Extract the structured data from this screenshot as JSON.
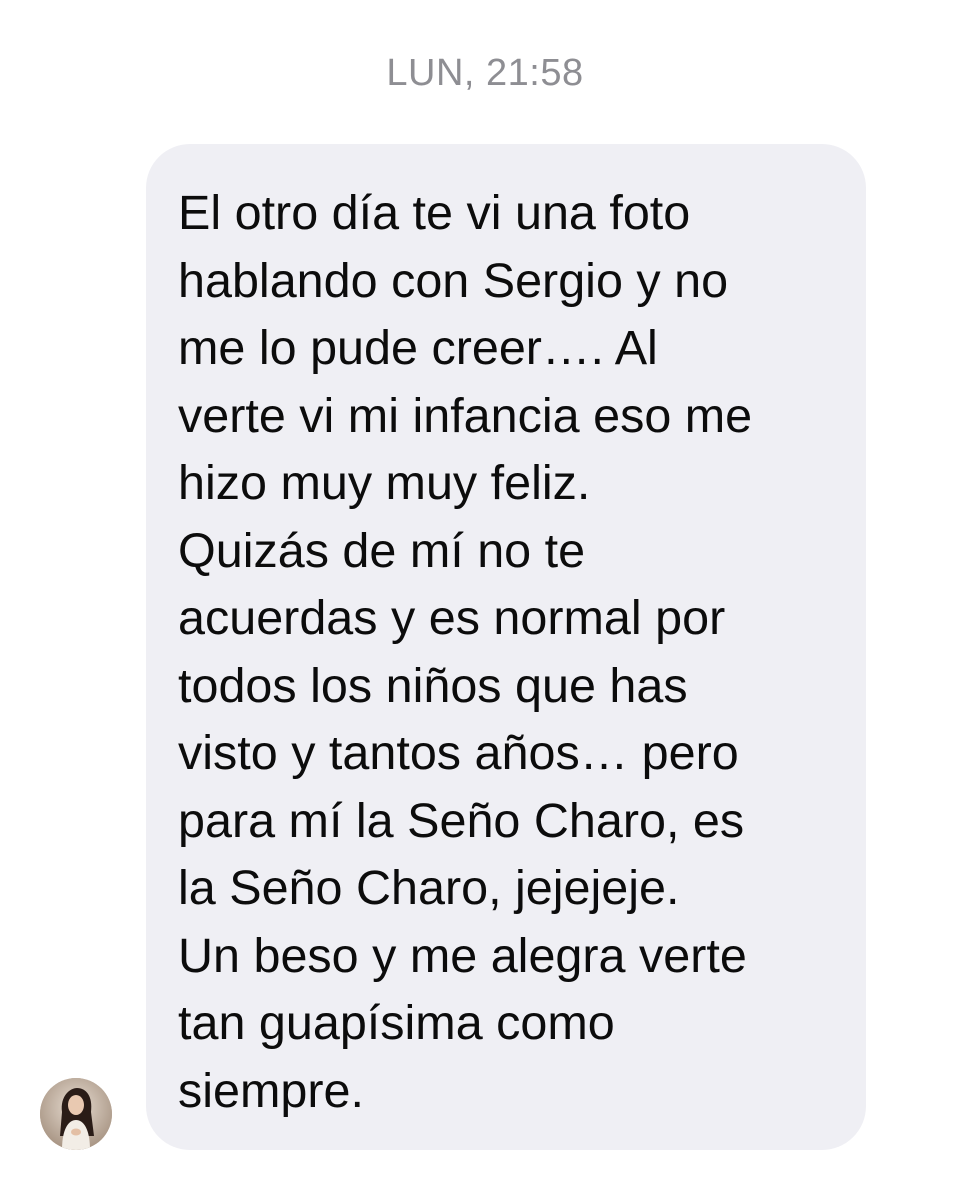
{
  "conversation": {
    "timestamp": "LUN, 21:58",
    "messages": [
      {
        "direction": "incoming",
        "text": "El otro día te vi una foto\nhablando con Sergio y no\nme lo pude creer…. Al\nverte vi mi infancia eso me\nhizo muy muy feliz.\nQuizás de mí no te\nacuerdas y es normal por\ntodos los niños que has\nvisto y tantos años… pero\npara mí la Seño Charo, es\nla Seño Charo, jejejeje.\nUn beso y me alegra verte\ntan guapísima como\nsiempre.",
        "bubble_color": "#efeff4",
        "text_color": "#0c0c0c"
      }
    ]
  },
  "sender": {
    "avatar_icon": "contact-photo"
  }
}
